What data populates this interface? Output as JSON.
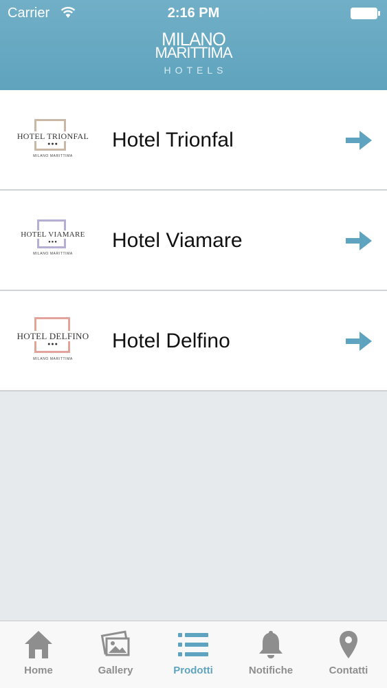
{
  "status_bar": {
    "carrier": "Carrier",
    "time": "2:16 PM"
  },
  "brand": {
    "line1": "MILANO",
    "line2": "MARITTIMA",
    "line3": "HOTELS"
  },
  "hotels": [
    {
      "title": "Hotel Trionfal",
      "logo_name": "HOTEL TRIONFAL",
      "logo_sub": "MILANO MARITTIMA",
      "logo_color": "#c9b8a6"
    },
    {
      "title": "Hotel Viamare",
      "logo_name": "HOTEL VIAMARE",
      "logo_sub": "MILANO MARITTIMA",
      "logo_color": "#b7aed6"
    },
    {
      "title": "Hotel Delfino",
      "logo_name": "HOTEL DELFINO",
      "logo_sub": "MILANO MARITTIMA",
      "logo_color": "#e2a39b"
    }
  ],
  "tabs": [
    {
      "label": "Home",
      "icon": "home-icon"
    },
    {
      "label": "Gallery",
      "icon": "gallery-icon"
    },
    {
      "label": "Prodotti",
      "icon": "list-icon",
      "active": true
    },
    {
      "label": "Notifiche",
      "icon": "bell-icon"
    },
    {
      "label": "Contatti",
      "icon": "location-pin-icon"
    }
  ],
  "colors": {
    "header": "#65a7c1",
    "accent": "#5ea3bf",
    "inactive_tab": "#8e8e8e",
    "background": "#e6eaed"
  }
}
